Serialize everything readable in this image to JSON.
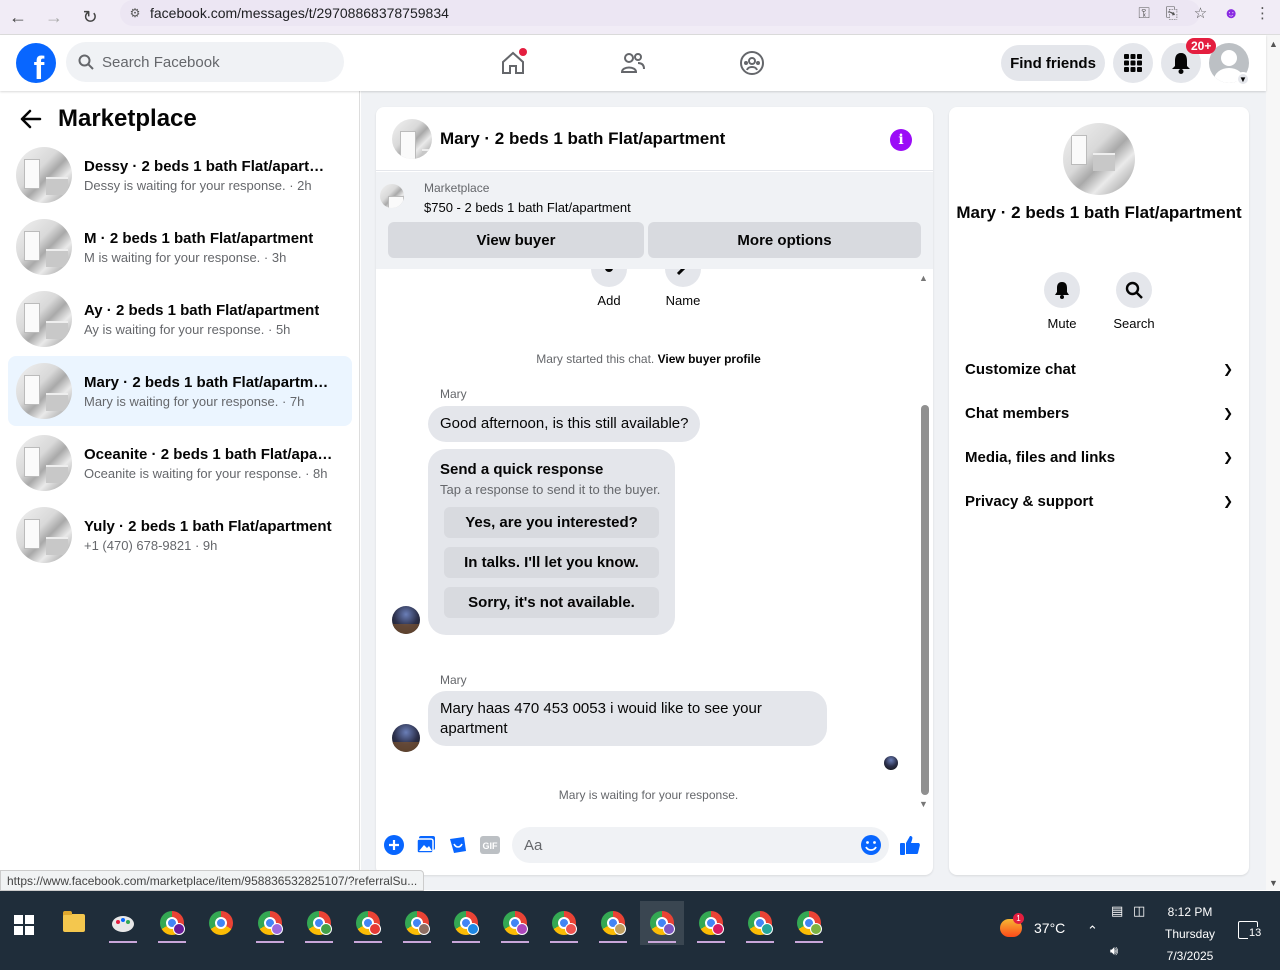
{
  "browser": {
    "url": "facebook.com/messages/t/29708868378759834"
  },
  "header": {
    "logo": "f",
    "search_placeholder": "Search Facebook",
    "find_friends_label": "Find friends",
    "notification_badge": "20+"
  },
  "sidebar": {
    "title": "Marketplace",
    "conversations": [
      {
        "title": "Dessy · 2 beds 1 bath Flat/apartment",
        "subtitle": "Dessy is waiting for your response. · 2h",
        "active": false
      },
      {
        "title": "M · 2 beds 1 bath Flat/apartment",
        "subtitle": "M is waiting for your response. · 3h",
        "active": false
      },
      {
        "title": "Ay · 2 beds 1 bath Flat/apartment",
        "subtitle": "Ay is waiting for your response. · 5h",
        "active": false
      },
      {
        "title": "Mary · 2 beds 1 bath Flat/apartment",
        "subtitle": "Mary is waiting for your response. · 7h",
        "active": true
      },
      {
        "title": "Oceanite · 2 beds 1 bath Flat/apart...",
        "subtitle": "Oceanite is waiting for your response. · 8h",
        "active": false
      },
      {
        "title": "Yuly · 2 beds 1 bath Flat/apartment",
        "subtitle": "+1 (470) 678-9821 · 9h",
        "active": false
      }
    ]
  },
  "chat": {
    "title": "Mary · 2 beds 1 bath Flat/apartment",
    "listing": {
      "source": "Marketplace",
      "price_title": "$750 - 2 beds 1 bath Flat/apartment",
      "view_buyer_label": "View buyer",
      "more_options_label": "More options"
    },
    "actions": {
      "add_label": "Add",
      "name_label": "Name"
    },
    "started_text": "Mary started this chat.",
    "view_profile_link": "View buyer profile",
    "sender_name": "Mary",
    "message_1": "Good afternoon, is this still available?",
    "quick_response": {
      "title": "Send a quick response",
      "subtitle": "Tap a response to send it to the buyer.",
      "options": [
        "Yes, are you interested?",
        "In talks. I'll let you know.",
        "Sorry, it's not available."
      ]
    },
    "message_2": "Mary haas 470 453 0053 i wouid like to   see your apartment",
    "waiting_text": "Mary is waiting for your response.",
    "composer_placeholder": "Aa"
  },
  "info_panel": {
    "title": "Mary · 2 beds 1 bath Flat/apartment",
    "mute_label": "Mute",
    "search_label": "Search",
    "sections": [
      "Customize chat",
      "Chat members",
      "Media, files and links",
      "Privacy & support"
    ]
  },
  "status_bar": {
    "link": "https://www.facebook.com/marketplace/item/958836532825107/?referralSu..."
  },
  "taskbar": {
    "temperature": "37°C",
    "weather_badge": "1",
    "time": "8:12 PM",
    "day": "Thursday",
    "date": "7/3/2025",
    "notifications": "13"
  },
  "colors": {
    "facebook_blue": "#0866ff",
    "messenger_purple": "#9b0cf7",
    "active_conversation": "#ebf5ff",
    "notification_red": "#e41e3f"
  }
}
